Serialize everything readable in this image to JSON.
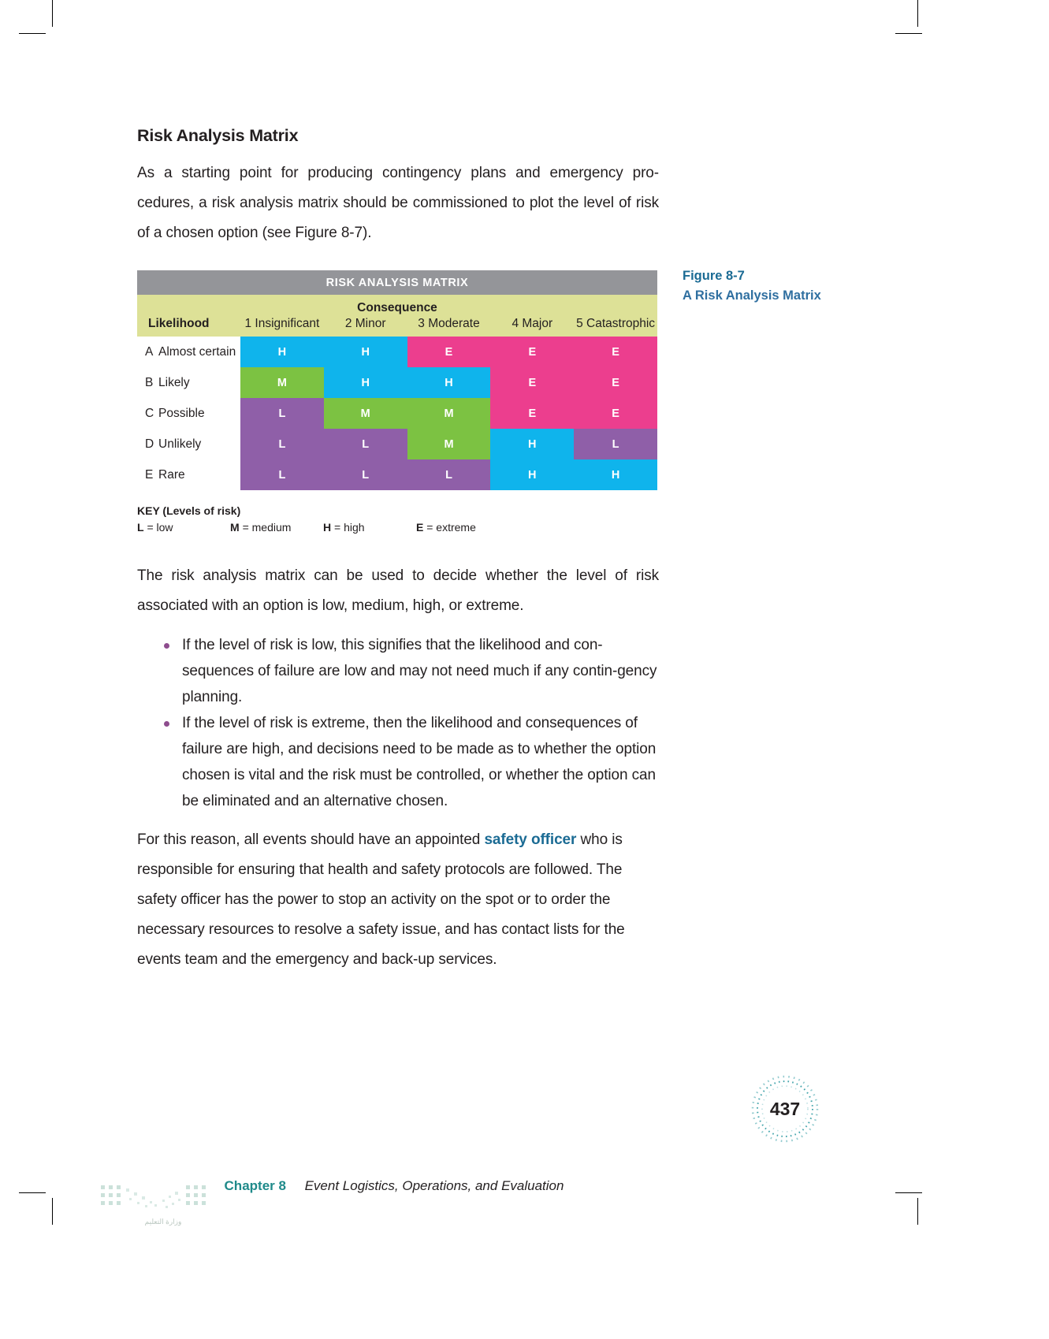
{
  "section": {
    "title": "Risk Analysis Matrix",
    "intro": "As a starting point for producing contingency plans and emergency pro-cedures, a risk analysis matrix should be commissioned to plot the level of risk of a chosen option (see Figure 8-7)."
  },
  "figure": {
    "banner": "RISK ANALYSIS MATRIX",
    "consequence_label": "Consequence",
    "likelihood_label": "Likelihood",
    "columns": [
      "1 Insignificant",
      "2 Minor",
      "3 Moderate",
      "4 Major",
      "5 Catastrophic"
    ],
    "rows": [
      {
        "letter": "A",
        "name": "Almost certain"
      },
      {
        "letter": "B",
        "name": "Likely"
      },
      {
        "letter": "C",
        "name": "Possible"
      },
      {
        "letter": "D",
        "name": "Unlikely"
      },
      {
        "letter": "E",
        "name": "Rare"
      }
    ],
    "caption_number": "Figure 8-7",
    "caption_text": "A Risk Analysis Matrix"
  },
  "chart_data": {
    "type": "heatmap",
    "title": "RISK ANALYSIS MATRIX",
    "xlabel": "Consequence",
    "ylabel": "Likelihood",
    "categories_x": [
      "1 Insignificant",
      "2 Minor",
      "3 Moderate",
      "4 Major",
      "5 Catastrophic"
    ],
    "categories_y": [
      "A Almost certain",
      "B Likely",
      "C Possible",
      "D Unlikely",
      "E Rare"
    ],
    "legend": [
      "L = low",
      "M = medium",
      "H = high",
      "E = extreme"
    ],
    "grid": false,
    "cells": [
      [
        "H",
        "H",
        "E",
        "E",
        "E"
      ],
      [
        "M",
        "H",
        "H",
        "E",
        "E"
      ],
      [
        "L",
        "M",
        "M",
        "E",
        "E"
      ],
      [
        "L",
        "L",
        "M",
        "H",
        "L"
      ],
      [
        "L",
        "L",
        "L",
        "H",
        "H"
      ]
    ],
    "level_colors": {
      "L": "#8f5fa8",
      "M": "#7cc242",
      "H": "#0fb4ec",
      "E": "#ec3e8e"
    }
  },
  "key": {
    "title": "KEY (Levels of risk)",
    "items": [
      {
        "symbol": "L",
        "text": "= low"
      },
      {
        "symbol": "M",
        "text": "= medium"
      },
      {
        "symbol": "H",
        "text": "= high"
      },
      {
        "symbol": "E",
        "text": "= extreme"
      }
    ]
  },
  "body": {
    "para_after_figure": "The risk analysis matrix can be used to decide whether the level of risk associated with an option is low, medium, high, or extreme.",
    "bullets": [
      "If the level of risk is low, this signifies that the likelihood and con-sequences of failure are low and may not need much if any contin-gency planning.",
      "If the level of risk is extreme, then the likelihood and consequences of failure are high, and decisions need to be made as to whether the option chosen is vital and the risk must be controlled, or whether the option can be eliminated and an alternative chosen."
    ],
    "final_para_before_keyword": "For this reason, all events should have an appointed ",
    "keyword": "safety officer",
    "final_para_after_keyword": " who is responsible for ensuring that health and safety protocols are followed. The safety officer has the power to stop an activity on the spot or to order the necessary resources to resolve a safety issue, and has contact lists for the events team and the emergency and back-up services."
  },
  "footer": {
    "chapter": "Chapter 8",
    "chapter_title": "Event Logistics, Operations, and Evaluation",
    "page_number": "437"
  },
  "colors": {
    "banner_gray": "#949599",
    "header_olive": "#dde197",
    "accent_blue": "#1b6b94",
    "footer_teal": "#1f8a8a",
    "bullet_purple": "#8e4d8e"
  }
}
